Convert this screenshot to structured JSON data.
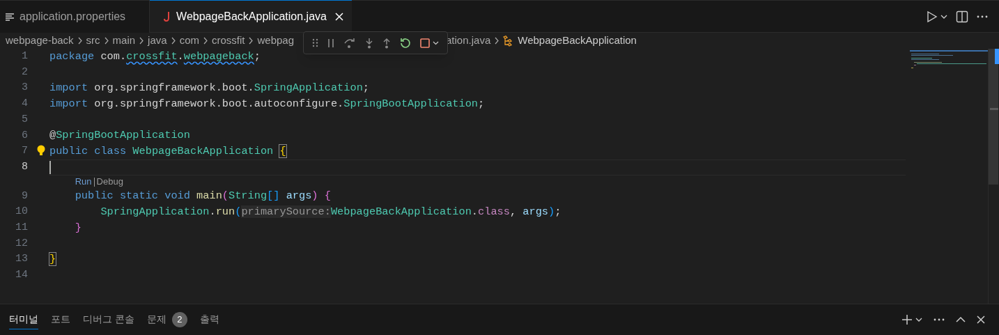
{
  "tabs": [
    {
      "label": "application.properties",
      "kind": "properties",
      "selected": false
    },
    {
      "label": "WebpageBackApplication.java",
      "kind": "java",
      "selected": true
    }
  ],
  "breadcrumb": [
    {
      "label": "webpage-back",
      "kind": "folder"
    },
    {
      "label": "src",
      "kind": "folder"
    },
    {
      "label": "main",
      "kind": "folder"
    },
    {
      "label": "java",
      "kind": "folder"
    },
    {
      "label": "com",
      "kind": "folder"
    },
    {
      "label": "crossfit",
      "kind": "folder"
    },
    {
      "label": "webpag",
      "kind": "covered"
    },
    {
      "label": "ation.java",
      "kind": "file"
    },
    {
      "label": "WebpageBackApplication",
      "kind": "class"
    }
  ],
  "debug_toolbar": [
    {
      "kind": "grip"
    },
    {
      "kind": "pause"
    },
    {
      "kind": "step-over"
    },
    {
      "kind": "step-into"
    },
    {
      "kind": "step-out"
    },
    {
      "kind": "restart"
    },
    {
      "kind": "stop"
    }
  ],
  "lines": [
    {
      "kind": "code",
      "number": "1",
      "tokens": [
        {
          "t": "package ",
          "color": "#569cd6"
        },
        {
          "t": "com.",
          "color": "#d4d4d4"
        },
        {
          "t": "crossfit",
          "color": "#4ec9b0",
          "squiggle": true
        },
        {
          "t": "."
        },
        {
          "t": "webpageback",
          "color": "#4ec9b0",
          "squiggle": true
        },
        {
          "t": ";",
          "color": "#d4d4d4"
        }
      ]
    },
    {
      "kind": "code",
      "number": "2"
    },
    {
      "kind": "code",
      "number": "3",
      "tokens": [
        {
          "t": "import ",
          "color": "#569cd6"
        },
        {
          "t": "org.springframework.boot.",
          "color": "#d4d4d4"
        },
        {
          "t": "SpringApplication",
          "color": "#4ec9b0"
        },
        {
          "t": ";",
          "color": "#d4d4d4"
        }
      ]
    },
    {
      "kind": "code",
      "number": "4",
      "tokens": [
        {
          "t": "import ",
          "color": "#569cd6"
        },
        {
          "t": "org.springframework.boot.autoconfigure.",
          "color": "#d4d4d4"
        },
        {
          "t": "SpringBootApplication",
          "color": "#4ec9b0"
        },
        {
          "t": ";",
          "color": "#d4d4d4"
        }
      ]
    },
    {
      "kind": "code",
      "number": "5"
    },
    {
      "kind": "code",
      "number": "6",
      "tokens": [
        {
          "t": "@",
          "color": "#d4d4d4"
        },
        {
          "t": "SpringBootApplication",
          "color": "#4ec9b0"
        }
      ]
    },
    {
      "kind": "code",
      "number": "7",
      "lightbulb": true,
      "tokens": [
        {
          "t": "public class ",
          "color": "#569cd6"
        },
        {
          "t": "WebpageBackApplication ",
          "color": "#4ec9b0"
        },
        {
          "t": "{",
          "color": "#ffd700",
          "matched": true
        }
      ],
      "children": [
        {
          "kind": "code",
          "number": "8",
          "current": true
        },
        {
          "kind": "codelens",
          "links": [
            "Run",
            "Debug"
          ]
        },
        {
          "kind": "code",
          "number": "9",
          "tokens": [
            {
              "t": "public static void ",
              "color": "#569cd6"
            },
            {
              "t": "main",
              "color": "#dcdcaa"
            },
            {
              "t": "(",
              "color": "#da70d6"
            },
            {
              "t": "String",
              "color": "#4ec9b0"
            },
            {
              "t": "[] ",
              "color": "#179fff"
            },
            {
              "t": "args",
              "color": "#9cdcfe"
            },
            {
              "t": ") {",
              "color": "#da70d6"
            }
          ],
          "children": [
            {
              "kind": "code",
              "number": "10",
              "tokens": [
                {
                  "t": "SpringApplication",
                  "color": "#4ec9b0"
                },
                {
                  "t": "."
                },
                {
                  "t": "run",
                  "color": "#dcdcaa"
                },
                {
                  "t": "(",
                  "color": "#179fff"
                },
                {
                  "t": "primarySource:",
                  "color": "#969696",
                  "hint": true
                },
                {
                  "t": "WebpageBackApplication",
                  "color": "#4ec9b0"
                },
                {
                  "t": "."
                },
                {
                  "t": "class",
                  "color": "#c586c0"
                },
                {
                  "t": ", ",
                  "color": "#d4d4d4"
                },
                {
                  "t": "args",
                  "color": "#9cdcfe"
                },
                {
                  "t": ")",
                  "color": "#179fff"
                },
                {
                  "t": ";",
                  "color": "#d4d4d4"
                }
              ]
            }
          ]
        },
        {
          "kind": "code",
          "number": "11",
          "tokens": [
            {
              "t": "}",
              "color": "#da70d6"
            }
          ]
        },
        {
          "kind": "code",
          "number": "12"
        }
      ]
    },
    {
      "kind": "code",
      "number": "13",
      "tokens": [
        {
          "t": "}",
          "color": "#ffd700",
          "matched": true
        }
      ]
    },
    {
      "kind": "code",
      "number": "14"
    }
  ],
  "panel": {
    "tabs": [
      {
        "label": "터미널",
        "selected": true
      },
      {
        "label": "포트",
        "selected": false
      },
      {
        "label": "디버그 콘솔",
        "selected": false
      },
      {
        "label": "문제",
        "selected": false,
        "badge": "2"
      },
      {
        "label": "출력",
        "selected": false
      }
    ]
  }
}
